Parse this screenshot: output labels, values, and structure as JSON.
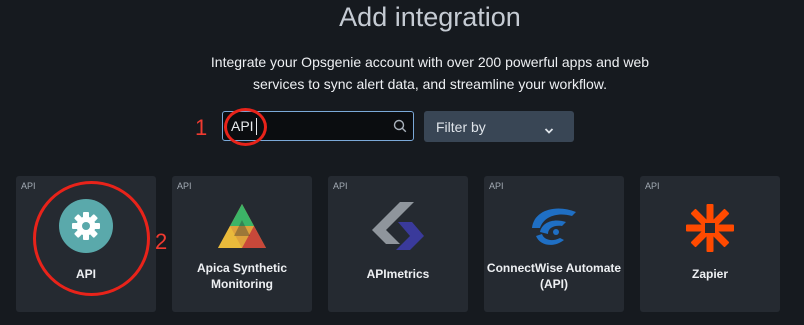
{
  "header": {
    "title": "Add integration",
    "subtitle": "Integrate your Opsgenie account with over 200 powerful apps and web services to sync alert data, and streamline your workflow."
  },
  "annotations": {
    "step1": "1",
    "step2": "2"
  },
  "search": {
    "value": "API",
    "icon": "search-icon"
  },
  "filter": {
    "label": "Filter by",
    "icon": "chevron-down-icon"
  },
  "cards": [
    {
      "tag": "API",
      "name": "API",
      "icon": "gear-icon"
    },
    {
      "tag": "API",
      "name": "Apica Synthetic Monitoring",
      "icon": "apica-logo"
    },
    {
      "tag": "API",
      "name": "APImetrics",
      "icon": "apimetrics-logo"
    },
    {
      "tag": "API",
      "name": "ConnectWise Automate (API)",
      "icon": "connectwise-logo"
    },
    {
      "tag": "API",
      "name": "Zapier",
      "icon": "zapier-logo"
    }
  ],
  "colors": {
    "annotation": "#e8231a",
    "background": "#161a1f",
    "card": "#252a31",
    "search_focus": "#7ba9d8"
  }
}
